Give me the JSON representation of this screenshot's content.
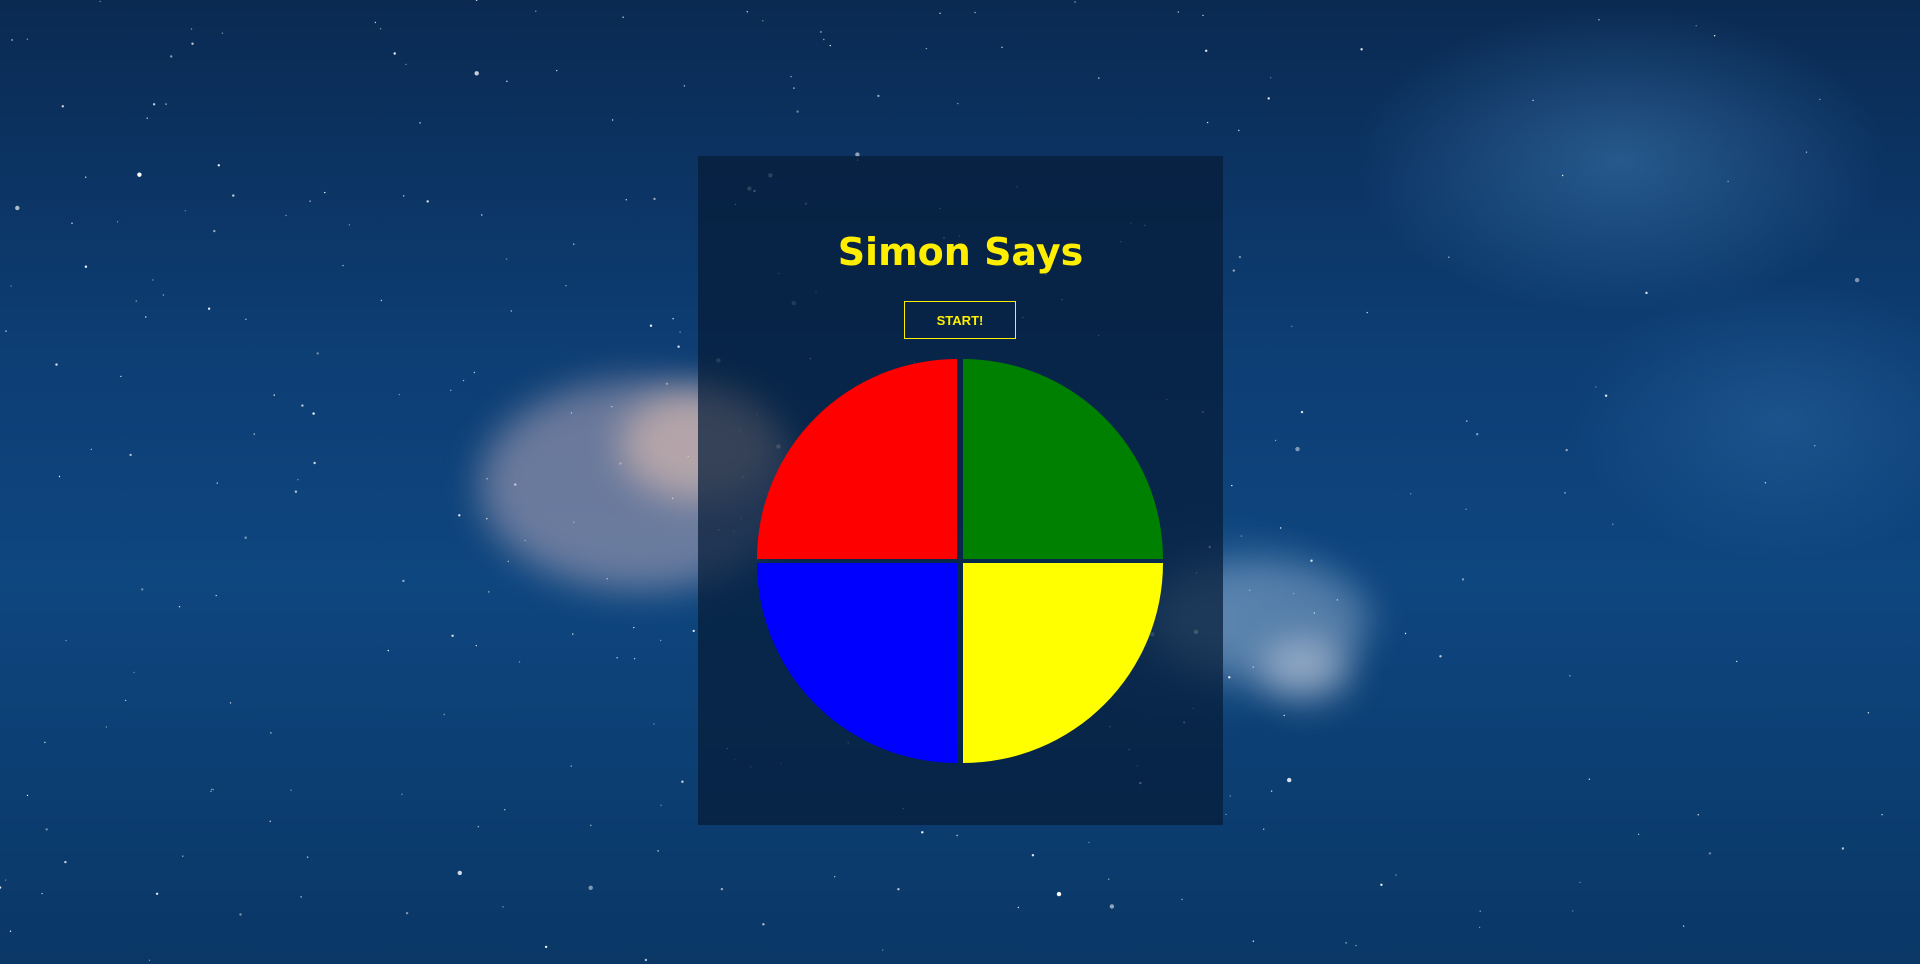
{
  "game": {
    "title": "Simon Says",
    "start_label": "START!"
  },
  "colors": {
    "accent": "#ffee00",
    "background": "#0d3d73",
    "panel": "#051c38"
  },
  "pads": [
    {
      "name": "red",
      "color": "#ff0000"
    },
    {
      "name": "green",
      "color": "#008000"
    },
    {
      "name": "blue",
      "color": "#0000ff"
    },
    {
      "name": "yellow",
      "color": "#ffff00"
    }
  ]
}
